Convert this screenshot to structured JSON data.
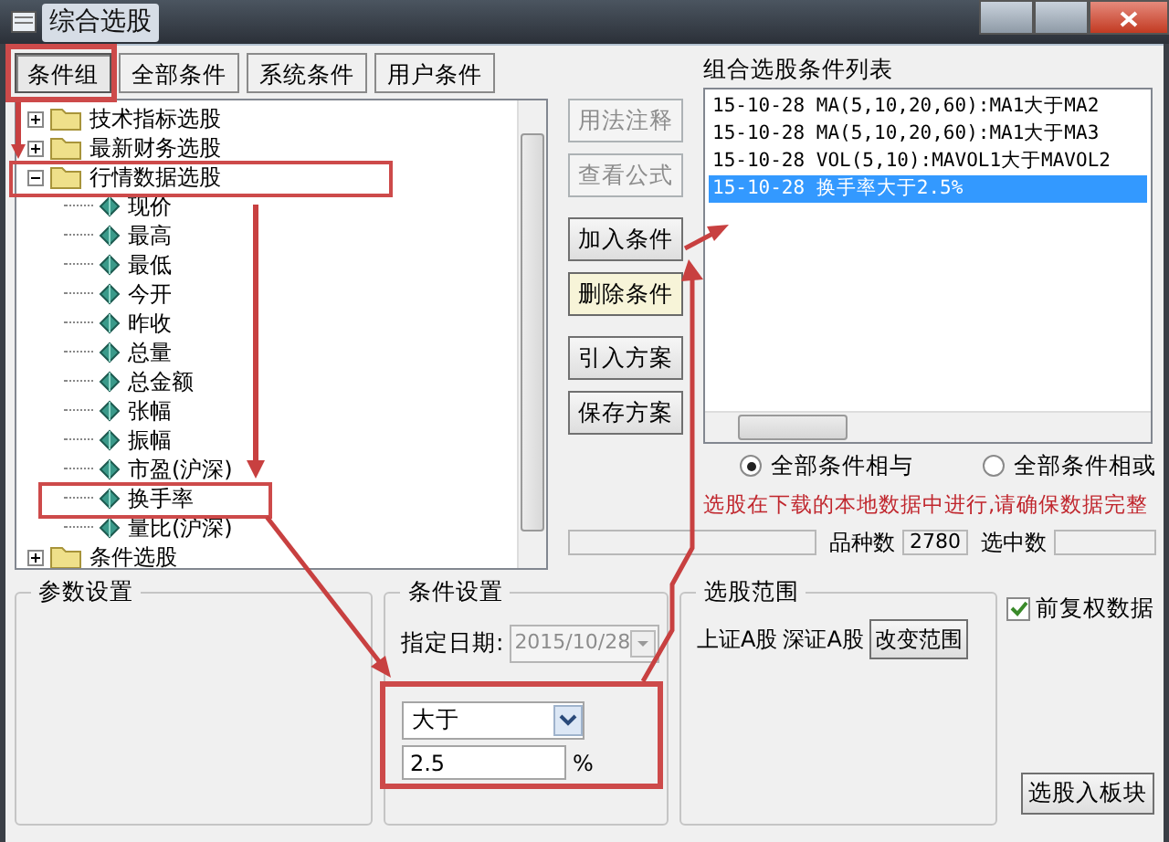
{
  "window": {
    "title": "综合选股"
  },
  "tabs": [
    {
      "label": "条件组",
      "selected": true,
      "highlighted": true
    },
    {
      "label": "全部条件",
      "selected": false,
      "highlighted": false
    },
    {
      "label": "系统条件",
      "selected": false,
      "highlighted": false
    },
    {
      "label": "用户条件",
      "selected": false,
      "highlighted": false
    }
  ],
  "tree": [
    {
      "label": "技术指标选股",
      "expanded": false,
      "highlighted": false
    },
    {
      "label": "最新财务选股",
      "expanded": false,
      "highlighted": false
    },
    {
      "label": "行情数据选股",
      "expanded": true,
      "highlighted": true,
      "children": [
        {
          "label": "现价",
          "highlighted": false
        },
        {
          "label": "最高",
          "highlighted": false
        },
        {
          "label": "最低",
          "highlighted": false
        },
        {
          "label": "今开",
          "highlighted": false
        },
        {
          "label": "昨收",
          "highlighted": false
        },
        {
          "label": "总量",
          "highlighted": false
        },
        {
          "label": "总金额",
          "highlighted": false
        },
        {
          "label": "张幅",
          "highlighted": false
        },
        {
          "label": "振幅",
          "highlighted": false
        },
        {
          "label": "市盈(沪深)",
          "highlighted": false
        },
        {
          "label": "换手率",
          "highlighted": true
        },
        {
          "label": "量比(沪深)",
          "highlighted": false
        }
      ]
    },
    {
      "label": "条件选股",
      "expanded": false,
      "highlighted": false
    }
  ],
  "action_buttons": [
    {
      "label": "用法注释",
      "disabled": true,
      "focused": false
    },
    {
      "label": "查看公式",
      "disabled": true,
      "focused": false
    },
    {
      "label": "加入条件",
      "disabled": false,
      "focused": false
    },
    {
      "label": "删除条件",
      "disabled": false,
      "focused": true
    },
    {
      "label": "引入方案",
      "disabled": false,
      "focused": false
    },
    {
      "label": "保存方案",
      "disabled": false,
      "focused": false
    }
  ],
  "condition_list": {
    "title": "组合选股条件列表",
    "items": [
      {
        "text": "15-10-28 MA(5,10,20,60):MA1大于MA2",
        "selected": false
      },
      {
        "text": "15-10-28 MA(5,10,20,60):MA1大于MA3",
        "selected": false
      },
      {
        "text": "15-10-28 VOL(5,10):MAVOL1大于MAVOL2",
        "selected": false
      },
      {
        "text": "15-10-28 换手率大于2.5%",
        "selected": true
      }
    ]
  },
  "logic_options": [
    {
      "label": "全部条件相与",
      "selected": true
    },
    {
      "label": "全部条件相或",
      "selected": false
    }
  ],
  "notice": "选股在下载的本地数据中进行,请确保数据完整",
  "status": {
    "variety_label": "品种数",
    "variety_count": "2780",
    "selected_label": "选中数"
  },
  "param_group": {
    "title": "参数设置"
  },
  "condition_group": {
    "title": "条件设置",
    "date_label": "指定日期:",
    "date_value": "2015/10/28",
    "date_disabled": true,
    "comparator": "大于",
    "threshold": "2.5",
    "unit": "%",
    "highlighted": true
  },
  "range_group": {
    "title": "选股范围",
    "markets": [
      "上证A股",
      "深证A股"
    ],
    "change_button": "改变范围"
  },
  "options": {
    "adjusted_label": "前复权数据",
    "adjusted_checked": true,
    "add_to_block_button": "选股入板块"
  }
}
